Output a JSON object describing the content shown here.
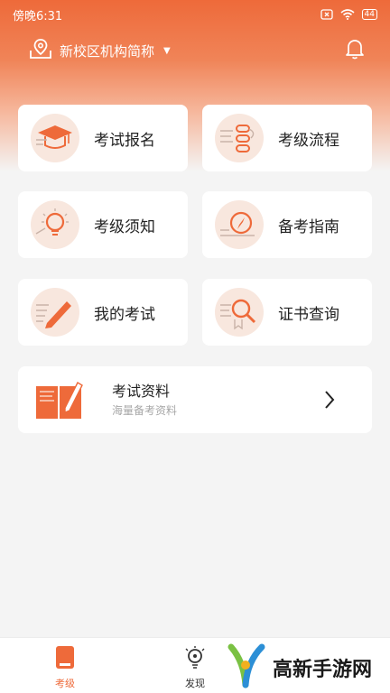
{
  "status_bar": {
    "time": "傍晚6:31",
    "battery": "44"
  },
  "header": {
    "campus_name": "新校区机构简称"
  },
  "grid": [
    {
      "label": "考试报名",
      "icon": "graduation-cap-icon"
    },
    {
      "label": "考级流程",
      "icon": "flowchart-icon"
    },
    {
      "label": "考级须知",
      "icon": "lightbulb-icon"
    },
    {
      "label": "备考指南",
      "icon": "compass-icon"
    },
    {
      "label": "我的考试",
      "icon": "pencil-icon"
    },
    {
      "label": "证书查询",
      "icon": "magnifier-icon"
    }
  ],
  "materials": {
    "title": "考试资料",
    "subtitle": "海量备考资料"
  },
  "tabs": [
    {
      "label": "考级",
      "active": true
    },
    {
      "label": "发现",
      "active": false
    }
  ],
  "watermark": {
    "text": "高新手游网"
  },
  "colors": {
    "accent": "#ee6a3a",
    "icon_bg": "#f8e7de"
  }
}
